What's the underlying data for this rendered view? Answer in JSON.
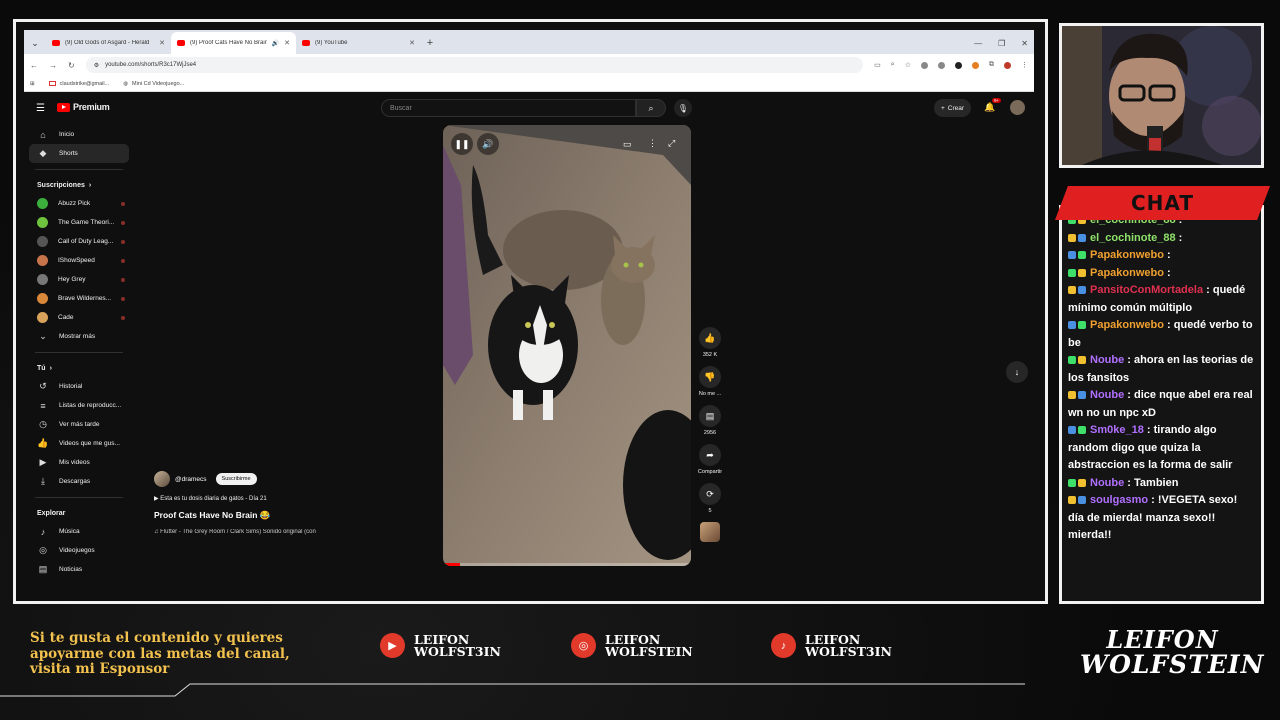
{
  "browser": {
    "tabs": [
      {
        "title": "(9) Old Gods of Asgard - Herald",
        "active": false
      },
      {
        "title": "(9) Proof Cats Have No Brain",
        "active": true
      },
      {
        "title": "(9) YouTube",
        "active": false
      }
    ],
    "url": "youtube.com/shorts/R3c17WjJse4",
    "bookmarks": [
      "claudstrike@gmail...",
      "Mini Cd Videojuego..."
    ]
  },
  "youtube": {
    "logo": "Premium",
    "search_placeholder": "Buscar",
    "create_label": "Crear",
    "notif_count": "9+",
    "sidebar": {
      "main": [
        {
          "label": "Inicio",
          "icon": "home-icon",
          "glyph": "⌂"
        },
        {
          "label": "Shorts",
          "icon": "shorts-icon",
          "glyph": "◆",
          "active": true
        }
      ],
      "subs_header": "Suscripciones",
      "subs": [
        {
          "label": "Abuzz Pick",
          "color": "#3cae3c"
        },
        {
          "label": "The Game Theori...",
          "color": "#6ec23d"
        },
        {
          "label": "Call of Duty Leag...",
          "color": "#555555"
        },
        {
          "label": "IShowSpeed",
          "color": "#c8744a"
        },
        {
          "label": "Hey Grey",
          "color": "#777777"
        },
        {
          "label": "Brave Wildernes...",
          "color": "#d9883a"
        },
        {
          "label": "Cade",
          "color": "#d9a25a"
        }
      ],
      "show_more": "Mostrar más",
      "you_header": "Tú",
      "you": [
        {
          "label": "Historial",
          "icon": "history-icon",
          "glyph": "↺"
        },
        {
          "label": "Listas de reproducc...",
          "icon": "playlist-icon",
          "glyph": "≡"
        },
        {
          "label": "Ver más tarde",
          "icon": "clock-icon",
          "glyph": "◷"
        },
        {
          "label": "Videos que me gus...",
          "icon": "thumb-up-icon",
          "glyph": "👍"
        },
        {
          "label": "Mis videos",
          "icon": "video-icon",
          "glyph": "▶"
        },
        {
          "label": "Descargas",
          "icon": "download-icon",
          "glyph": "⤓"
        }
      ],
      "explore_header": "Explorar",
      "explore": [
        {
          "label": "Música",
          "icon": "music-icon",
          "glyph": "♪"
        },
        {
          "label": "Videojuegos",
          "icon": "gamepad-icon",
          "glyph": "◎"
        },
        {
          "label": "Noticias",
          "icon": "news-icon",
          "glyph": "▤"
        }
      ]
    },
    "short": {
      "channel": "@dramecs",
      "subscribe_label": "Suscribirme",
      "description": "▶ Esta es tu dosis diaria de gatos - Día 21",
      "title": "Proof Cats Have No Brain 😂",
      "music": "♫  Flutter - The Grey Room / Clark Sims)    Sonido original (con",
      "progress": 0.07,
      "likes": "352 K",
      "dislike_label": "No me ...",
      "comments": "2956",
      "share_label": "Compartir",
      "remix_count": "5"
    }
  },
  "stream": {
    "chat_title": "CHAT",
    "chat": [
      {
        "user": "el_cochinote_88",
        "color": "#8ee26a",
        "text": ""
      },
      {
        "user": "el_cochinote_88",
        "color": "#8ee26a",
        "text": ""
      },
      {
        "user": "Papakonwebo",
        "color": "#f0a030",
        "text": ""
      },
      {
        "user": "Papakonwebo",
        "color": "#f0a030",
        "text": ""
      },
      {
        "user": "PansitoConMortadela",
        "color": "#e03050",
        "text": "quedé mínimo común múltiplo"
      },
      {
        "user": "Papakonwebo",
        "color": "#f0a030",
        "text": "quedé verbo to be"
      },
      {
        "user": "Noube",
        "color": "#b070ff",
        "text": "ahora en las teorias de los fansitos"
      },
      {
        "user": "Noube",
        "color": "#b070ff",
        "text": "dice nque abel era real wn no un npc xD"
      },
      {
        "user": "Sm0ke_18",
        "color": "#b070ff",
        "text": "tirando algo random digo que quiza la abstraccion es la forma de salir"
      },
      {
        "user": "Noube",
        "color": "#b070ff",
        "text": "Tambien"
      },
      {
        "user": "soulgasmo",
        "color": "#b070ff",
        "text": "!VEGETA sexo! día de mierda! manza sexo!! mierda!!"
      }
    ],
    "sponsor_text": "Si te gusta el contenido y quieres apoyarme con las metas del canal, visita mi Esponsor",
    "socials": [
      {
        "icon": "youtube-icon",
        "glyph": "▶",
        "line1": "LEIFON",
        "line2": "WOLFST3IN"
      },
      {
        "icon": "instagram-icon",
        "glyph": "◎",
        "line1": "LEIFON",
        "line2": "WOLFSTEIN"
      },
      {
        "icon": "tiktok-icon",
        "glyph": "♪",
        "line1": "LEIFON",
        "line2": "WOLFST3IN"
      }
    ],
    "brand_line1": "LEIFON",
    "brand_line2": "WOLFSTEIN"
  }
}
